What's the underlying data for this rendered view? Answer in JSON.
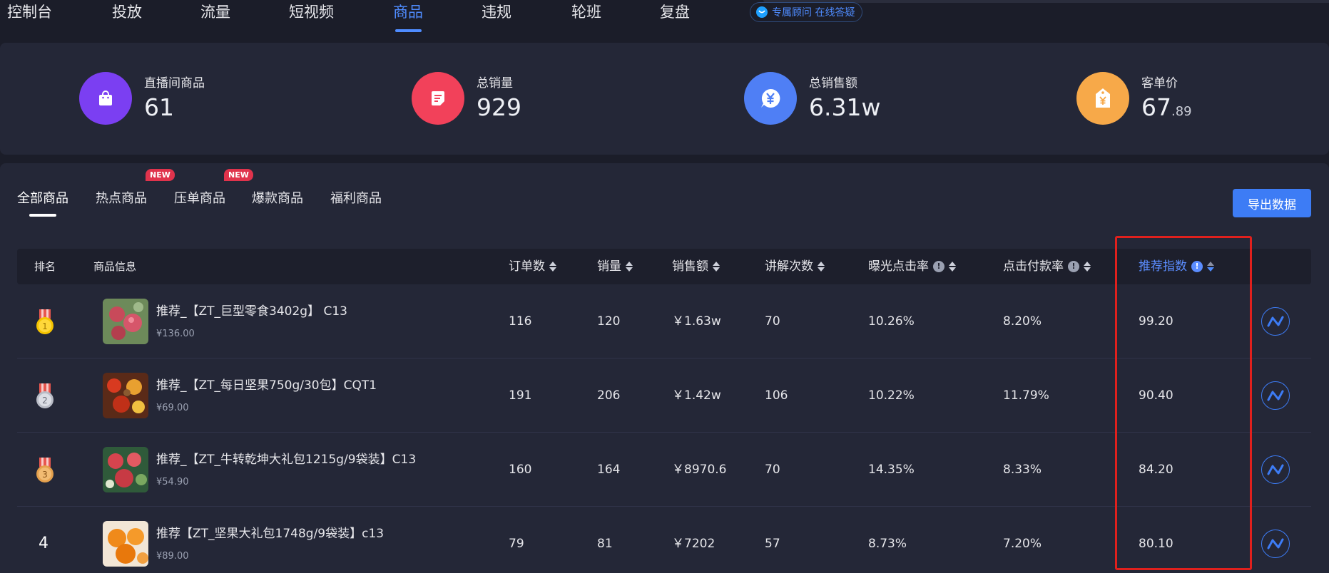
{
  "nav": {
    "items": [
      "控制台",
      "投放",
      "流量",
      "短视频",
      "商品",
      "违规",
      "轮班",
      "复盘"
    ],
    "active": "商品",
    "consult_label": "专属顾问 在线答疑"
  },
  "stats": [
    {
      "label": "直播间商品",
      "value": "61",
      "color": "#7b3ff2",
      "icon": "shopping-bag-icon"
    },
    {
      "label": "总销量",
      "value": "929",
      "color": "#f2415a",
      "icon": "document-icon"
    },
    {
      "label": "总销售额",
      "value": "6.31w",
      "color": "#4f7ff5",
      "icon": "yuan-coin-icon"
    },
    {
      "label": "客单价",
      "value_int": "67",
      "value_dec": ".89",
      "color": "#f7a949",
      "icon": "price-tag-icon"
    }
  ],
  "tabs": {
    "items": [
      "全部商品",
      "热点商品",
      "压单商品",
      "爆款商品",
      "福利商品"
    ],
    "new_badge": "NEW"
  },
  "export_label": "导出数据",
  "table": {
    "headers": {
      "rank": "排名",
      "product": "商品信息",
      "orders": "订单数",
      "sales": "销量",
      "revenue": "销售额",
      "explains": "讲解次数",
      "exposure_ctr": "曝光点击率",
      "click_pay": "点击付款率",
      "recommend": "推荐指数"
    },
    "rows": [
      {
        "rank": "1",
        "name": "推荐_【ZT_巨型零食3402g】 C13",
        "price": "¥136.00",
        "orders": "116",
        "sales": "120",
        "revenue": "￥1.63w",
        "explains": "70",
        "exposure_ctr": "10.26%",
        "click_pay": "8.20%",
        "recommend": "99.20"
      },
      {
        "rank": "2",
        "name": "推荐_【ZT_每日坚果750g/30包】CQT1",
        "price": "¥69.00",
        "orders": "191",
        "sales": "206",
        "revenue": "￥1.42w",
        "explains": "106",
        "exposure_ctr": "10.22%",
        "click_pay": "11.79%",
        "recommend": "90.40"
      },
      {
        "rank": "3",
        "name": "推荐_【ZT_牛转乾坤大礼包1215g/9袋装】C13",
        "price": "¥54.90",
        "orders": "160",
        "sales": "164",
        "revenue": "￥8970.6",
        "explains": "70",
        "exposure_ctr": "14.35%",
        "click_pay": "8.33%",
        "recommend": "84.20"
      },
      {
        "rank": "4",
        "name": "推荐【ZT_坚果大礼包1748g/9袋装】c13",
        "price": "¥89.00",
        "orders": "79",
        "sales": "81",
        "revenue": "￥7202",
        "explains": "57",
        "exposure_ctr": "8.73%",
        "click_pay": "7.20%",
        "recommend": "80.10"
      }
    ]
  },
  "colors": {
    "accent": "#4f8cff",
    "highlight_box": "#e0201d",
    "gold": "#f5c400",
    "silver": "#c7cad3",
    "bronze": "#e4a04d"
  }
}
